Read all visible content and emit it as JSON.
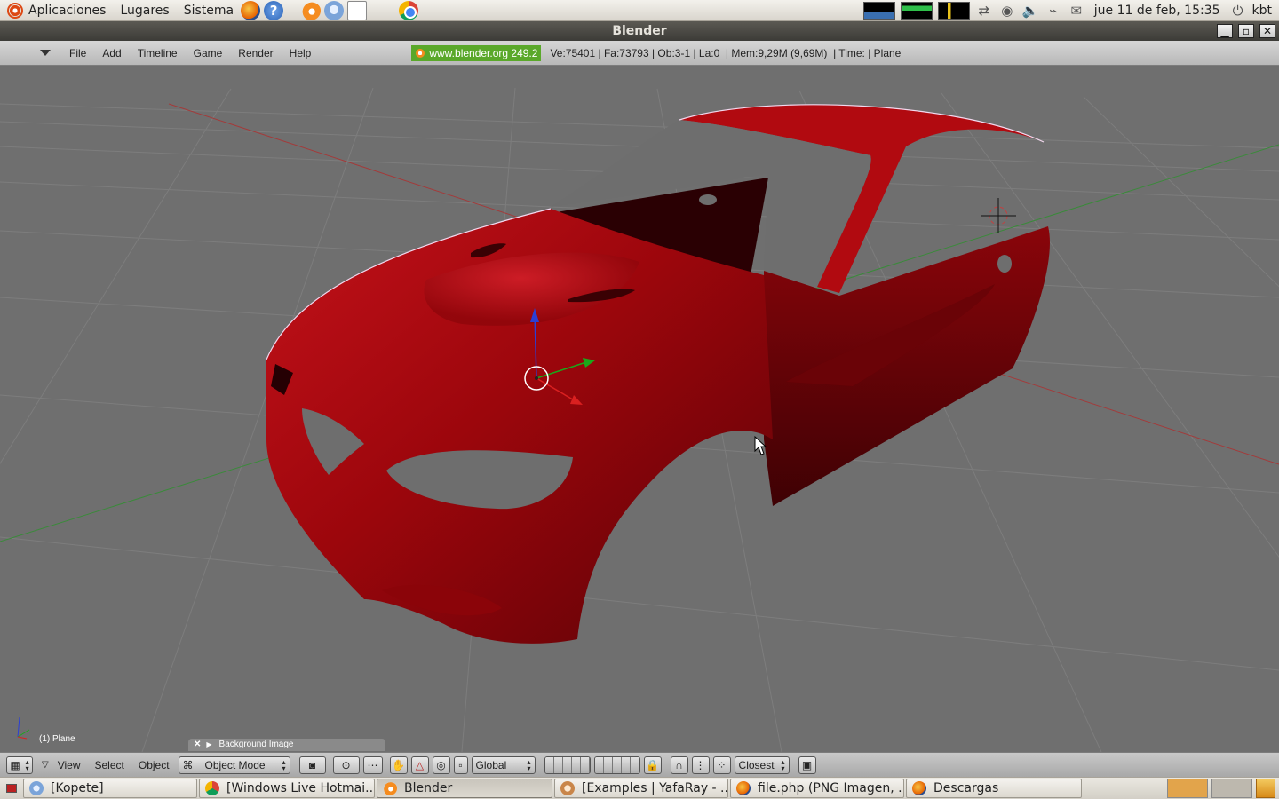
{
  "top_panel": {
    "menus": [
      "Aplicaciones",
      "Lugares",
      "Sistema"
    ],
    "help_glyph": "?",
    "clock": "jue 11 de feb, 15:35",
    "user": "kbt",
    "icons": [
      "ubuntu-logo",
      "firefox-icon",
      "help-icon",
      "blender-icon",
      "pidgin-icon",
      "text-editor-icon",
      "chrome-icon",
      "cpu-graph",
      "memory-graph",
      "network-graph",
      "network-icon",
      "pidgin-tray-icon",
      "volume-icon",
      "wireless-icon",
      "mail-icon",
      "power-icon"
    ]
  },
  "window": {
    "title": "Blender",
    "buttons": {
      "minimize": "▁",
      "maximize": "▫",
      "close": "✕"
    }
  },
  "info_header": {
    "menus": [
      "File",
      "Add",
      "Timeline",
      "Game",
      "Render",
      "Help"
    ],
    "site": "www.blender.org 249.2",
    "stats": "Ve:75401 | Fa:73793 | Ob:3-1 | La:0  | Mem:9,29M (9,69M)  | Time: | Plane"
  },
  "viewport": {
    "object_label": "(1) Plane",
    "background_panel_label": "Background Image",
    "background_panel_close": "✕",
    "background_panel_arrow": "▶",
    "mesh_color": "#a8070c",
    "grid_color": "#7b7b7b"
  },
  "view_header": {
    "menus": [
      "View",
      "Select",
      "Object"
    ],
    "mode": "Object Mode",
    "orientation": "Global",
    "snap": "Closest"
  },
  "taskbar": {
    "tasks": [
      {
        "label": "[Kopete]",
        "icon": "pidgin"
      },
      {
        "label": "[Windows Live Hotmai...",
        "icon": "chrome"
      },
      {
        "label": "Blender",
        "icon": "blender",
        "active": true
      },
      {
        "label": "[Examples | YafaRay - ...",
        "icon": "yafaray"
      },
      {
        "label": "file.php (PNG Imagen, ...",
        "icon": "firefox"
      },
      {
        "label": "Descargas",
        "icon": "firefox"
      }
    ]
  }
}
